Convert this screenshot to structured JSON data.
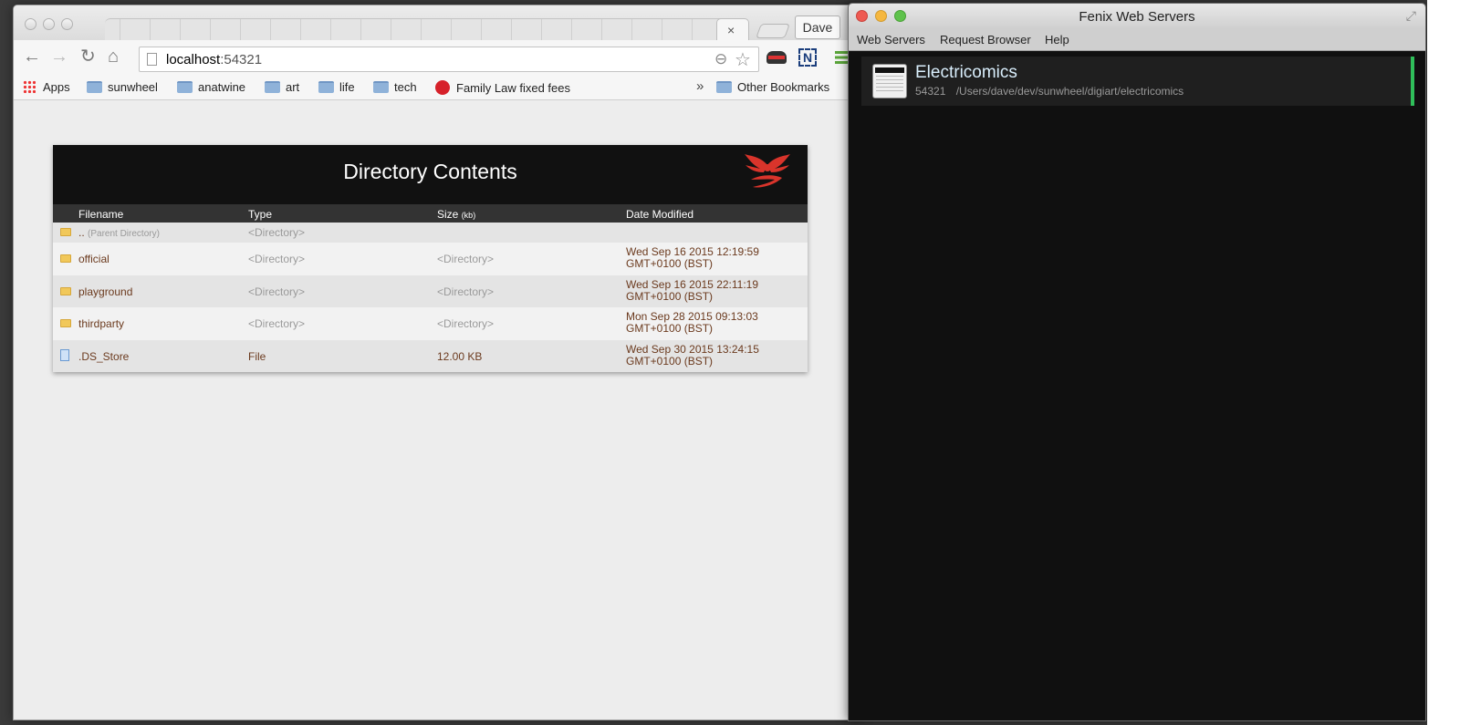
{
  "browser": {
    "profile_label": "Dave",
    "url_host": "localhost",
    "url_port": ":54321",
    "bookmarks": {
      "apps": "Apps",
      "items": [
        "sunwheel",
        "anatwine",
        "art",
        "life",
        "tech"
      ],
      "family_law": "Family Law fixed fees",
      "more": "»",
      "other": "Other Bookmarks"
    },
    "icons": {
      "back": "←",
      "forward": "→",
      "reload": "↻",
      "home": "⌂",
      "zoom": "⊖",
      "star": "☆",
      "close": "×",
      "fullscreen": "⤢",
      "chevron": "»"
    }
  },
  "directory": {
    "title": "Directory Contents",
    "columns": {
      "filename": "Filename",
      "type": "Type",
      "size": "Size",
      "size_unit": "(kb)",
      "date": "Date Modified"
    },
    "parent": {
      "name": "..",
      "hint": "(Parent Directory)",
      "type": "<Directory>"
    },
    "rows": [
      {
        "name": "official",
        "type": "<Directory>",
        "size": "<Directory>",
        "date1": "Wed Sep 16 2015 12:19:59",
        "date2": "GMT+0100 (BST)"
      },
      {
        "name": "playground",
        "type": "<Directory>",
        "size": "<Directory>",
        "date1": "Wed Sep 16 2015 22:11:19",
        "date2": "GMT+0100 (BST)"
      },
      {
        "name": "thirdparty",
        "type": "<Directory>",
        "size": "<Directory>",
        "date1": "Mon Sep 28 2015 09:13:03",
        "date2": "GMT+0100 (BST)"
      },
      {
        "name": ".DS_Store",
        "type": "File",
        "size": "12.00 KB",
        "date1": "Wed Sep 30 2015 13:24:15",
        "date2": "GMT+0100 (BST)"
      }
    ],
    "logo_color": "#d9342b"
  },
  "fenix": {
    "title": "Fenix Web Servers",
    "menu": [
      "Web Servers",
      "Request Browser",
      "Help"
    ],
    "server": {
      "name": "Electricomics",
      "port": "54321",
      "path": "/Users/dave/dev/sunwheel/digiart/electricomics",
      "status_color": "#2fbf5a"
    },
    "fullscreen_icon": "⤢"
  }
}
